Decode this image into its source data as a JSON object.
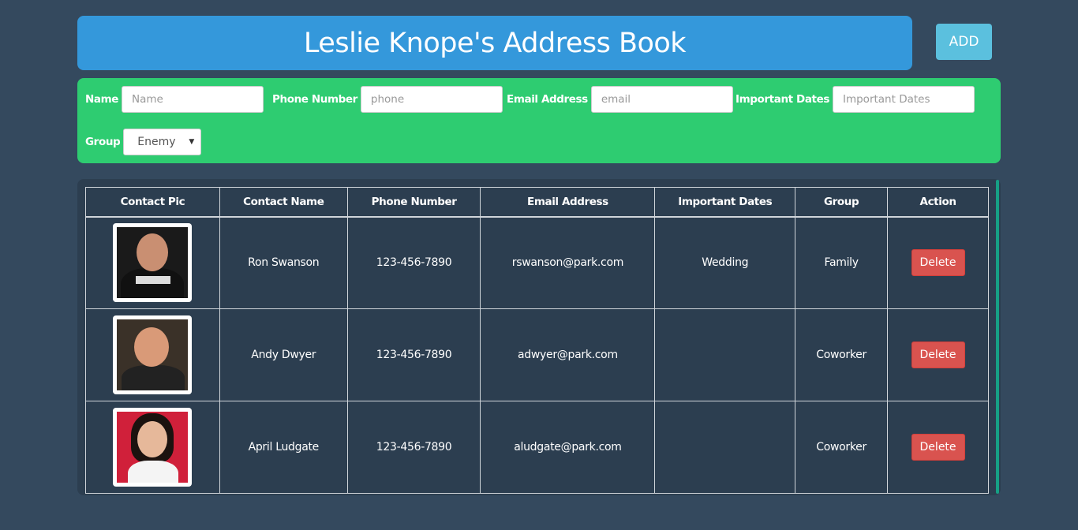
{
  "header": {
    "title": "Leslie Knope's Address Book",
    "add_label": "ADD"
  },
  "form": {
    "name_label": "Name",
    "name_placeholder": "Name",
    "phone_label": "Phone Number",
    "phone_placeholder": "phone",
    "email_label": "Email Address",
    "email_placeholder": "email",
    "dates_label": "Important Dates",
    "dates_placeholder": "Important Dates",
    "group_label": "Group",
    "group_selected": "Enemy"
  },
  "table": {
    "columns": [
      "Contact Pic",
      "Contact Name",
      "Phone Number",
      "Email Address",
      "Important Dates",
      "Group",
      "Action"
    ],
    "rows": [
      {
        "name": "Ron Swanson",
        "phone": "123-456-7890",
        "email": "rswanson@park.com",
        "dates": "Wedding",
        "group": "Family",
        "action": "Delete"
      },
      {
        "name": "Andy Dwyer",
        "phone": "123-456-7890",
        "email": "adwyer@park.com",
        "dates": "",
        "group": "Coworker",
        "action": "Delete"
      },
      {
        "name": "April Ludgate",
        "phone": "123-456-7890",
        "email": "aludgate@park.com",
        "dates": "",
        "group": "Coworker",
        "action": "Delete"
      }
    ]
  },
  "colors": {
    "background": "#34495e",
    "header": "#3498db",
    "add_button": "#5bc0de",
    "form_panel": "#2ecc71",
    "table_bg": "#2c3e50",
    "delete_button": "#d9534f"
  }
}
